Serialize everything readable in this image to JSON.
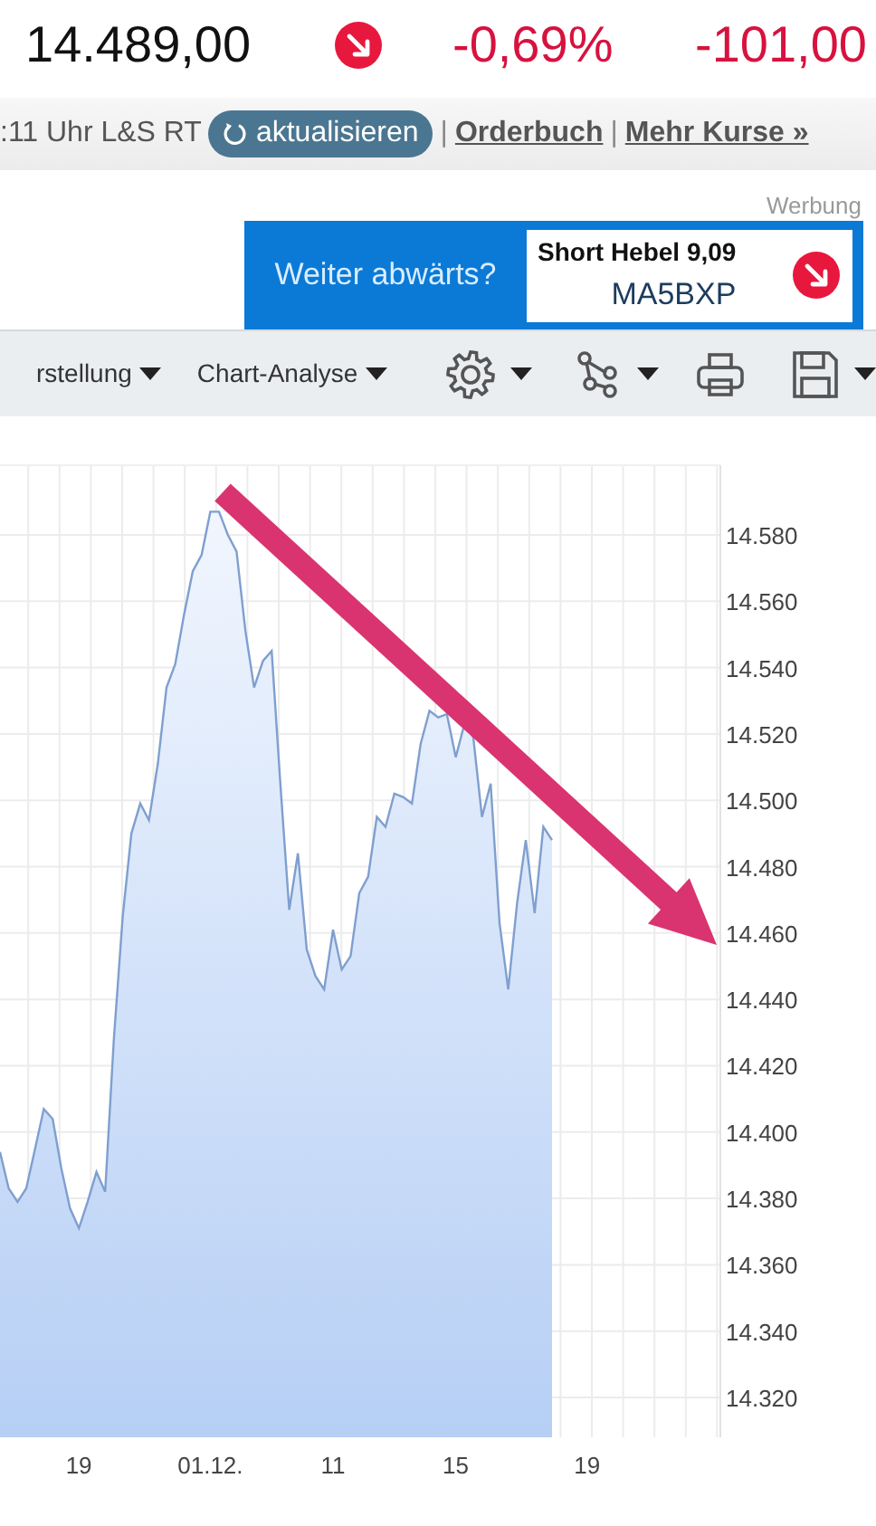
{
  "quote": {
    "price": "14.489,00",
    "negative": true,
    "change_percent": "-0,69%",
    "change_abs": "-101,00"
  },
  "info_bar": {
    "items": [
      {
        "kind": "text",
        "text": ":11 Uhr L&S RT"
      },
      {
        "kind": "button",
        "text": "aktualisieren"
      },
      {
        "kind": "separator",
        "text": "|"
      },
      {
        "kind": "link",
        "text": "Orderbuch"
      },
      {
        "kind": "separator",
        "text": "|"
      },
      {
        "kind": "link",
        "text": "Mehr Kurse »"
      }
    ]
  },
  "ad": {
    "label": "Werbung",
    "headline": "Weiter abwärts?",
    "product": "Short Hebel 9,09",
    "code": "MA5BXP",
    "negative": true
  },
  "toolbar": {
    "items": [
      {
        "kind": "menu",
        "label": "rstellung"
      },
      {
        "kind": "menu",
        "label": "Chart-Analyse"
      },
      {
        "kind": "gear"
      },
      {
        "kind": "nodes"
      },
      {
        "kind": "printer"
      },
      {
        "kind": "floppy"
      }
    ]
  },
  "chart_data": {
    "type": "area",
    "grid": true,
    "ylim": [
      14308,
      14601
    ],
    "categories": [
      null,
      null,
      null,
      null,
      null,
      null,
      null,
      null,
      null,
      null,
      "19",
      null,
      null,
      null,
      null,
      null,
      null,
      null,
      null,
      null,
      null,
      null,
      null,
      null,
      null,
      "01.12.",
      null,
      null,
      null,
      null,
      null,
      null,
      null,
      null,
      null,
      null,
      null,
      null,
      null,
      "11",
      null,
      null,
      null,
      null,
      null,
      null,
      null,
      null,
      null,
      null,
      null,
      null,
      null,
      "15",
      null,
      null,
      null,
      null,
      null,
      null,
      null,
      null,
      null,
      null,
      null,
      null,
      null,
      null,
      "19",
      null,
      null,
      null,
      null,
      null,
      null,
      null,
      null,
      null,
      null,
      null,
      null,
      null
    ],
    "series": [
      {
        "color": "#7f9fcf",
        "values": [
          null,
          14394,
          14383,
          14379,
          14383,
          14395,
          14407,
          14404,
          14389,
          14377,
          14371,
          14379,
          14388,
          14382,
          14428,
          14465,
          14490,
          14499,
          14494,
          14511,
          14534,
          14541,
          14556,
          14569,
          14574,
          14587,
          14587,
          14580,
          14575,
          14551,
          14534,
          14542,
          14545,
          14505,
          14467,
          14484,
          14455,
          14447,
          14443,
          14461,
          14449,
          14453,
          14472,
          14477,
          14495,
          14492,
          14502,
          14501,
          14499,
          14517,
          14527,
          14525,
          14526,
          14513,
          14523,
          14519,
          14495,
          14505,
          14463,
          14443,
          14469,
          14488,
          14466,
          14492,
          14488,
          null,
          null,
          null,
          null,
          null,
          null,
          null,
          null,
          null,
          null,
          null,
          null,
          null,
          null,
          null,
          null,
          null
        ]
      }
    ],
    "yticks": [
      {
        "value": 14320,
        "label": "14.320"
      },
      {
        "value": 14340,
        "label": "14.340"
      },
      {
        "value": 14360,
        "label": "14.360"
      },
      {
        "value": 14380,
        "label": "14.380"
      },
      {
        "value": 14400,
        "label": "14.400"
      },
      {
        "value": 14420,
        "label": "14.420"
      },
      {
        "value": 14440,
        "label": "14.440"
      },
      {
        "value": 14460,
        "label": "14.460"
      },
      {
        "value": 14480,
        "label": "14.480"
      },
      {
        "value": 14500,
        "label": "14.500"
      },
      {
        "value": 14520,
        "label": "14.520"
      },
      {
        "value": 14540,
        "label": "14.540"
      },
      {
        "value": 14560,
        "label": "14.560"
      },
      {
        "value": 14580,
        "label": "14.580"
      }
    ]
  }
}
